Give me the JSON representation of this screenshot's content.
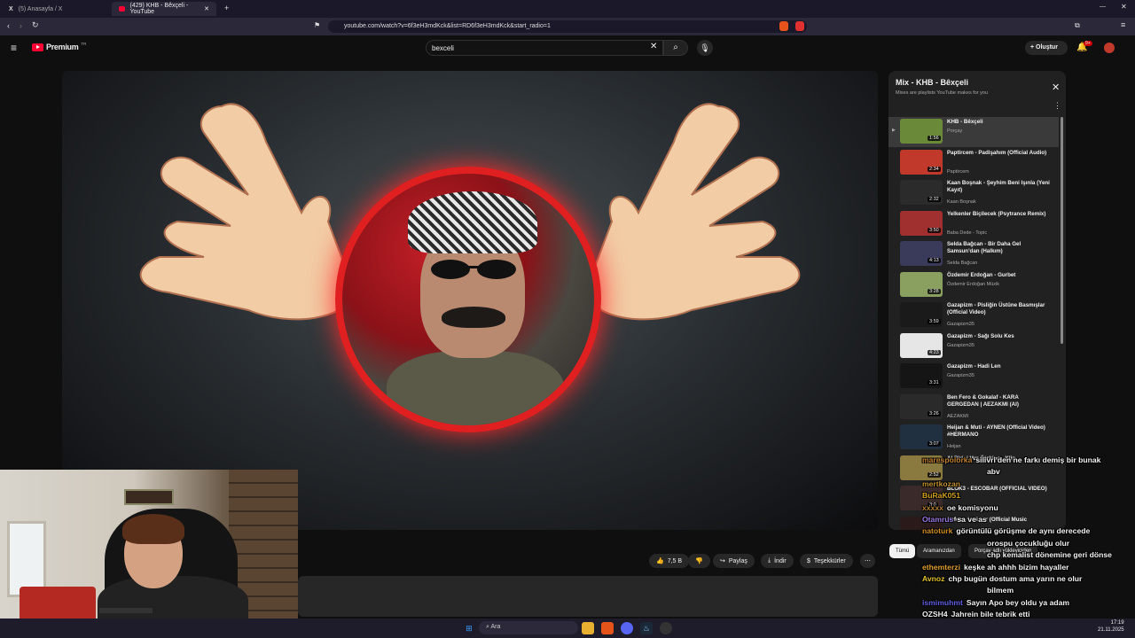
{
  "browser": {
    "tabs": [
      {
        "label": "(5) Anasayfa / X"
      },
      {
        "label": "(429) KHB - Bêxçeli - YouTube"
      }
    ],
    "url": "youtube.com/watch?v=6f3eH3mdKck&list=RD6f3eH3mdKck&start_radio=1"
  },
  "youtube": {
    "logo": "Premium",
    "logo_sup": "TR",
    "search_value": "bexceli",
    "create_label": "Oluştur",
    "notif_count": "9+"
  },
  "video_actions": {
    "like_count": "7,5 B",
    "share": "Paylaş",
    "download": "İndir",
    "thanks": "Teşekkürler"
  },
  "playlist": {
    "title": "Mix - KHB - Bêxçeli",
    "subtitle": "Mixes are playlists YouTube makes for you",
    "items": [
      {
        "title": "KHB - Bêxçeli",
        "channel": "Porçay",
        "duration": "1:56",
        "color": "#6a8a3a"
      },
      {
        "title": "Paptircem - Padişahım (Official Audio)",
        "channel": "Paptircem",
        "duration": "2:34",
        "color": "#c0392b"
      },
      {
        "title": "Kaan Boşnak - Şeyhim Beni Işınla (Yeni Kayıt)",
        "channel": "Kaan Boşnak",
        "duration": "2:32",
        "color": "#2b2b2b"
      },
      {
        "title": "Yelkenler Biçilecek (Psytrance Remix)",
        "channel": "Baba Dede - Topic",
        "duration": "3:50",
        "color": "#a03030"
      },
      {
        "title": "Selda Bağcan - Bir Daha Gel Samsun'dan (Halkım)",
        "channel": "Selda Bağcan",
        "duration": "4:13",
        "color": "#3a3a5a"
      },
      {
        "title": "Özdemir Erdoğan - Gurbet",
        "channel": "Özdemir Erdoğan Müzik",
        "duration": "3:28",
        "color": "#8aa060"
      },
      {
        "title": "Gazapizm - Pisliğin Üstüne Basmışlar (Official Video)",
        "channel": "Gazapizm35",
        "duration": "3:59",
        "color": "#1a1a1a"
      },
      {
        "title": "Gazapizm - Sağı Solu Kes",
        "channel": "Gazapizm35",
        "duration": "4:23",
        "color": "#e6e6e6"
      },
      {
        "title": "Gazapizm - Hadi Len",
        "channel": "Gazapizm35",
        "duration": "3:31",
        "color": "#151515"
      },
      {
        "title": "Ben Fero & Gokalaf - KARA GERGEDAN | AEZAKMI (AI)",
        "channel": "AEZAKMI",
        "duration": "3:26",
        "color": "#2a2a2a"
      },
      {
        "title": "Heijan & Muti - AYNEN (Official Video) #HERMANO",
        "channel": "Heijan",
        "duration": "3:07",
        "color": "#203040"
      },
      {
        "title": "Al Birini Vur Ötekine - Klip",
        "channel": "",
        "duration": "2:52",
        "color": "#8a7a40"
      },
      {
        "title": "BLOK3 - ESCOBAR (OFFICIAL VIDEO)",
        "channel": "",
        "duration": "3:0",
        "color": "#3a2a2a"
      },
      {
        "title": "Nefes - Geri Ver (Official Music",
        "channel": "",
        "duration": "2:50",
        "color": "#2a1a1a"
      }
    ]
  },
  "chips": [
    "Tümü",
    "Aramanızdan",
    "Porçay adlı yükleyiciden"
  ],
  "chat": [
    {
      "user": "marespolorka",
      "msg": "silivri'den ne farkı demiş bir bunak",
      "color": "#c08030"
    },
    {
      "user": "",
      "msg": "abv",
      "color": "#c08030"
    },
    {
      "user": "mertkozan",
      "msg": "",
      "color": "#c09030"
    },
    {
      "user": "BuRaK051",
      "msg": "",
      "color": "#d0a020"
    },
    {
      "user": "xxxxx",
      "msg": "oe komisyonu",
      "color": "#b08030"
    },
    {
      "user": "Otamrus",
      "msg": "sa ve as",
      "color": "#9a7ae0"
    },
    {
      "user": "natoturk",
      "msg": "görüntülü görüşme de aynı derecede",
      "color": "#d09020"
    },
    {
      "user": "",
      "msg": "orospu çocukluğu olur",
      "color": "#d09020"
    },
    {
      "user": "",
      "msg": "chp kemalist dönemine geri dönse",
      "color": "#d09020"
    },
    {
      "user": "ethemterzi",
      "msg": "keşke ah ahhh bizim hayaller",
      "color": "#e0a030"
    },
    {
      "user": "Avnoz",
      "msg": "chp bugün dostum ama yarın ne olur",
      "color": "#e0c030"
    },
    {
      "user": "",
      "msg": "bilmem",
      "color": "#e0c030"
    },
    {
      "user": "ismimuhmt",
      "msg": "Sayın Apo bey oldu ya adam",
      "color": "#6060e0"
    },
    {
      "user": "OZSH4",
      "msg": "Jahrein bile tebrik etti",
      "color": "#f0f0f0"
    }
  ],
  "taskbar": {
    "search_placeholder": "Ara",
    "time": "17:19",
    "date": "21.11.2025"
  }
}
